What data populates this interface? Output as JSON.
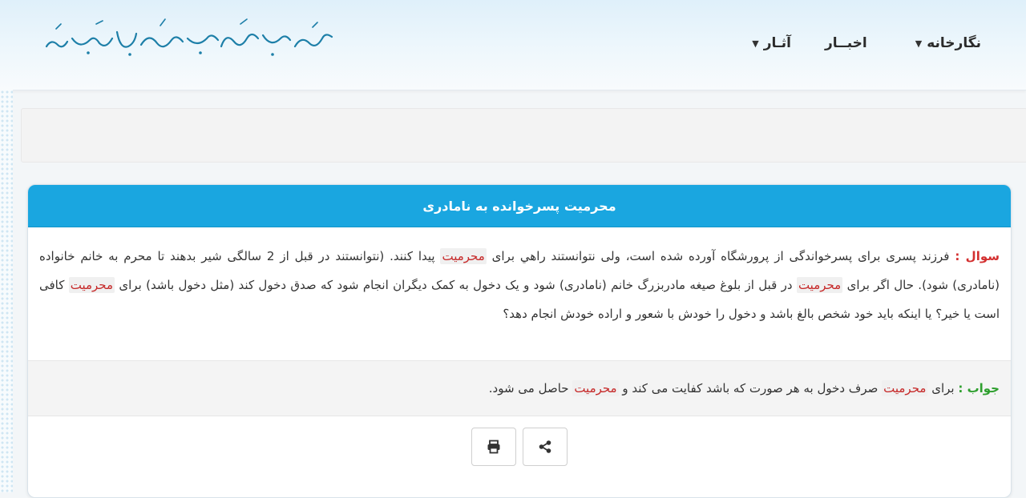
{
  "header": {
    "logo_text": "حضرت آیة الله العظمی سید محمود هاشمی شاهرودی",
    "nav": [
      {
        "label": "",
        "has_caret": true
      },
      {
        "label": "آثـار",
        "has_caret": false
      },
      {
        "label": "اخبــار",
        "has_caret": false
      },
      {
        "label": "نگارخانه",
        "has_caret": true
      }
    ]
  },
  "card": {
    "title": "محرمیت پسرخوانده به نامادری",
    "question_label": "سوال :",
    "question_parts": [
      " فرزند پسری برای پسرخواندگی از پرورشگاه آورده شده است، ولی نتوانستند راهي برای ",
      "محرمیت",
      " پیدا کنند. (نتوانستند در قبل از 2 سالگی شیر بدهند تا محرم به خانم خانواده (نامادری) شود). حال اگر برای ",
      "محرمیت",
      " در قبل از بلوغ صیغه مادربزرگ خانم (نامادری) شود و یک دخول به کمک دیگران انجام شود که صدق دخول کند (مثل دخول باشد) برای ",
      "محرمیت",
      " کافی است یا خیر؟ یا اینکه باید خود شخص بالغ باشد و دخول را خودش با شعور و اراده خودش انجام دهد؟"
    ],
    "answer_label": "جواب :",
    "answer_parts": [
      " برای ",
      "محرمیت",
      " صرف دخول به هر صورت که باشد کفایت می کند و ",
      "محرمیت",
      " حاصل می شود."
    ]
  },
  "actions": {
    "print_icon": "print-icon",
    "share_icon": "share-icon"
  },
  "colors": {
    "title_bar": "#1aa6e0",
    "question_label": "#d32f2f",
    "answer_label": "#2e9f2e",
    "highlight_text": "#c62828"
  }
}
